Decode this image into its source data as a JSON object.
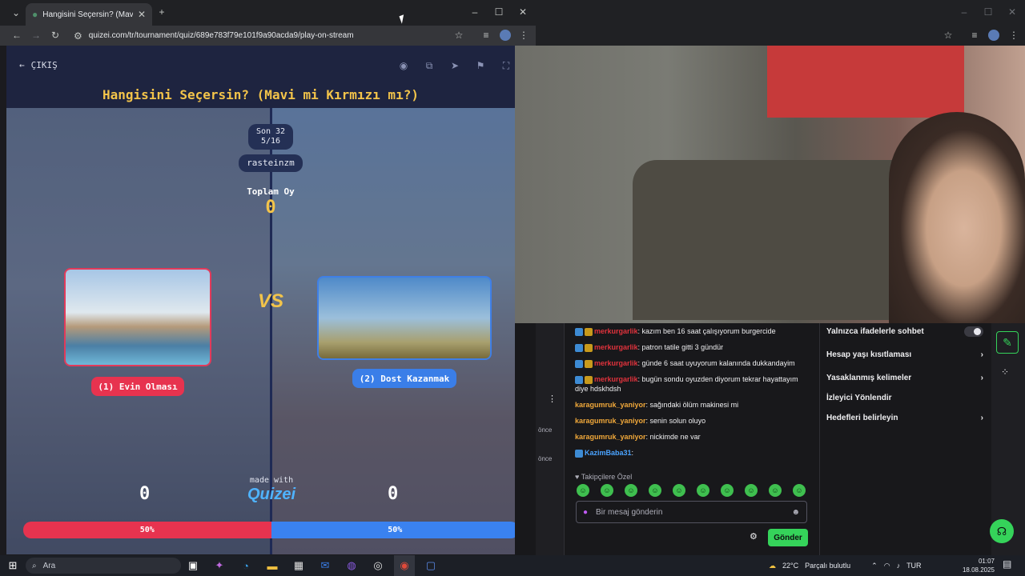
{
  "browser": {
    "tab_title": "Hangisini Seçersin? (Mavi mi Kı",
    "url": "quizei.com/tr/tournament/quiz/689e783f79e101f9a90acda9/play-on-stream"
  },
  "quiz": {
    "back_label": "ÇIKIŞ",
    "title": "Hangisini Seçersin? (Mavi mi Kırmızı mı?)",
    "round_line1": "Son 32",
    "round_line2": "5/16",
    "username": "rasteinzm",
    "total_votes_label": "Toplam Oy",
    "total_votes_value": "0",
    "vs_label": "VS",
    "option_left": "(1) Evin Olması",
    "option_right": "(2) Dost Kazanmak",
    "count_left": "0",
    "count_right": "0",
    "made_with": "made with",
    "brand": "Quizei",
    "percent_left": "50%",
    "percent_right": "50%",
    "percent_left_value": 50,
    "colors": {
      "left": "#e7334f",
      "right": "#3a82f0",
      "accent": "#f3c44a"
    }
  },
  "chat": {
    "messages": [
      {
        "user": "merkurgarlik",
        "text": ": kazım ben 16 saat çalışıyorum burgercide",
        "color": "#e0323c",
        "badges": true
      },
      {
        "user": "merkurgarlik",
        "text": ": patron tatile gitti 3 gündür",
        "color": "#e0323c",
        "badges": true
      },
      {
        "user": "merkurgarlik",
        "text": ": günde 6 saat uyuyorum kalanında dukkandayim",
        "color": "#e0323c",
        "badges": true
      },
      {
        "user": "merkurgarlik",
        "text": ": bugün sondu oyuzden diyorum tekrar hayattayım diye hdskhdsh",
        "color": "#e0323c",
        "badges": true
      },
      {
        "user": "karagumruk_yaniyor",
        "text": ": sağındaki ölüm makinesi mi",
        "color": "#f0a83a",
        "badges": false
      },
      {
        "user": "karagumruk_yaniyor",
        "text": ": senin solun oluyo",
        "color": "#f0a83a",
        "badges": false
      },
      {
        "user": "karagumruk_yaniyor",
        "text": ": nickimde ne var",
        "color": "#f0a83a",
        "badges": false
      },
      {
        "user": "KazimBaba31",
        "text": ":",
        "color": "#4aa3ff",
        "badges": true
      }
    ],
    "time_labels": [
      "önce",
      "önce"
    ],
    "follower_label": "Takipçilere Özel",
    "input_placeholder": "Bir mesaj gönderin",
    "send_label": "Gönder"
  },
  "settings": {
    "items": [
      {
        "label": "Yalnızca ifadelerle sohbet",
        "control": "toggle"
      },
      {
        "label": "Hesap yaşı kısıtlaması",
        "control": "chevron"
      },
      {
        "label": "Yasaklanmış kelimeler",
        "control": "chevron"
      },
      {
        "label": "İzleyici Yönlendir",
        "control": "none"
      },
      {
        "label": "Hedefleri belirleyin",
        "control": "chevron"
      }
    ]
  },
  "taskbar": {
    "search_label": "Ara",
    "weather": "22°C",
    "weather_desc": "Parçalı bulutlu",
    "language": "TUR",
    "time": "01:07",
    "date": "18.08.2025"
  }
}
